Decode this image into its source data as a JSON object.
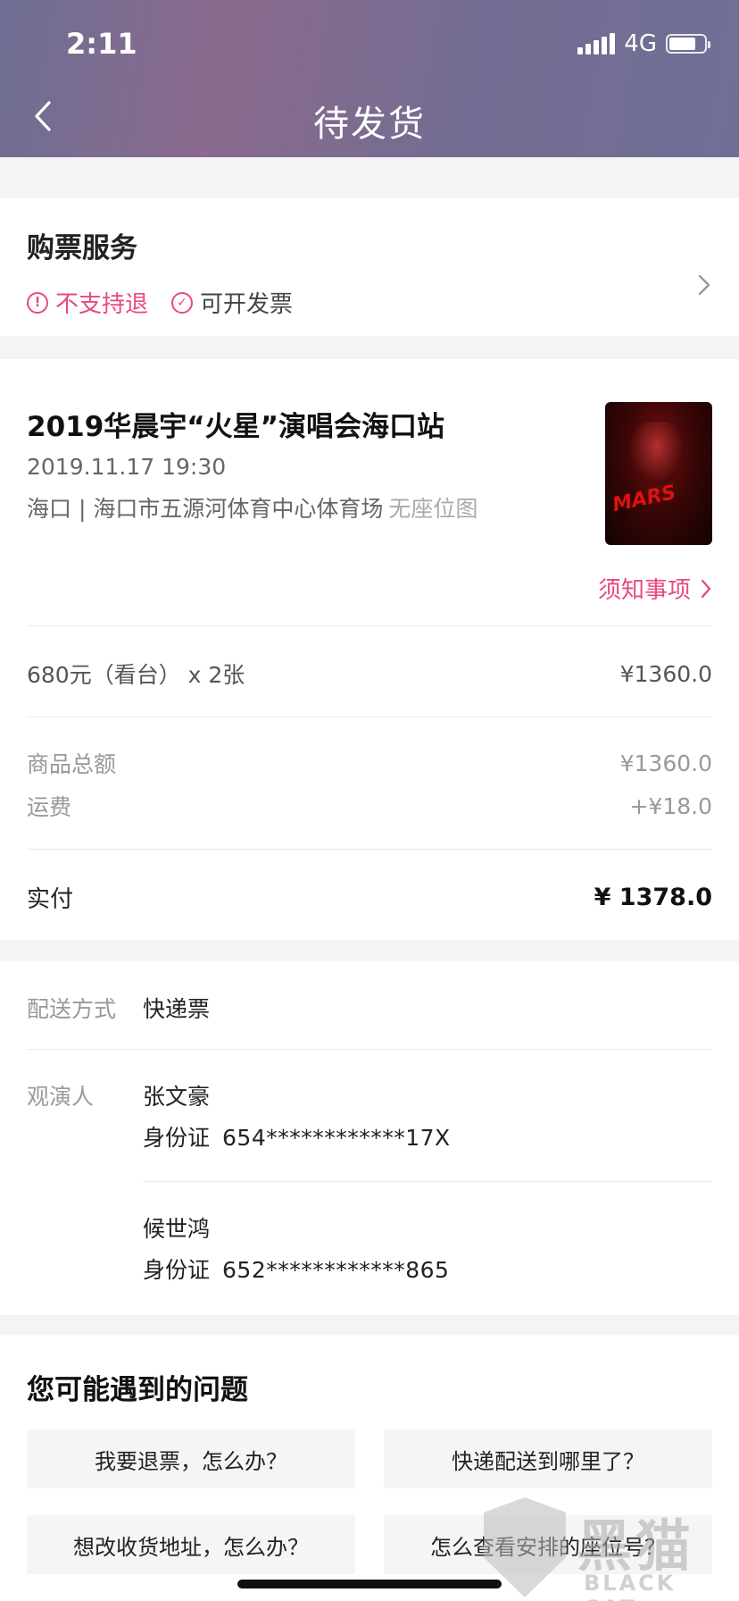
{
  "status_bar": {
    "time": "2:11",
    "network": "4G"
  },
  "header": {
    "title": "待发货"
  },
  "service": {
    "title": "购票服务",
    "no_refund": "不支持退",
    "invoice": "可开发票"
  },
  "order": {
    "event_title": "2019华晨宇“火星”演唱会海口站",
    "event_date": "2019.11.17 19:30",
    "event_venue": "海口 | 海口市五源河体育中心体育场",
    "no_seat_map": "无座位图",
    "poster_text": "MARS",
    "notice_link": "须知事项",
    "ticket_desc": "680元（看台） x 2张",
    "ticket_price": "¥1360.0",
    "subtotal_label": "商品总额",
    "subtotal_value": "¥1360.0",
    "shipping_label": "运费",
    "shipping_value": "+¥18.0",
    "paid_label": "实付",
    "paid_value": "¥ 1378.0"
  },
  "delivery": {
    "method_label": "配送方式",
    "method_value": "快递票",
    "viewers_label": "观演人",
    "viewers": [
      {
        "name": "张文豪",
        "id_label": "身份证",
        "id_number": "654************17X"
      },
      {
        "name": "候世鸿",
        "id_label": "身份证",
        "id_number": "652************865"
      }
    ]
  },
  "faq": {
    "title": "您可能遇到的问题",
    "questions": [
      "我要退票，怎么办？",
      "快递配送到哪里了？",
      "想改收货地址，怎么办？",
      "怎么查看安排的座位号？"
    ]
  },
  "watermark": {
    "cn": "黑猫",
    "en": "BLACK CAT"
  },
  "colors": {
    "accent": "#e84a7a",
    "header_gradient": "#7a6c92"
  }
}
